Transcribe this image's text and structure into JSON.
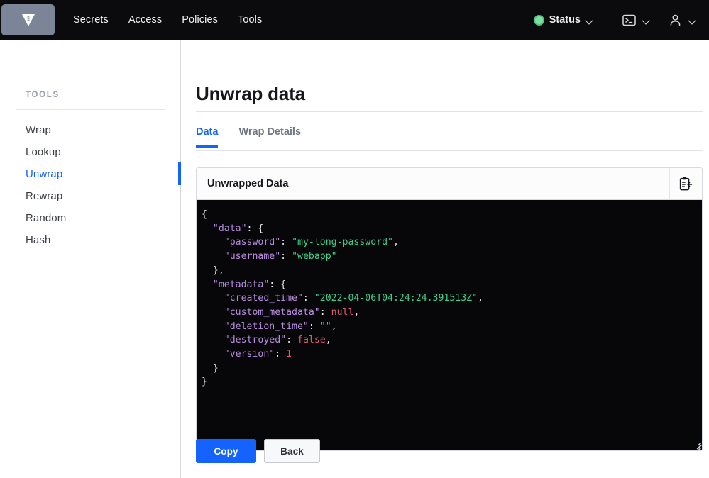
{
  "navbar": {
    "logo_icon": "vault-logo-icon",
    "links": [
      {
        "label": "Secrets"
      },
      {
        "label": "Access"
      },
      {
        "label": "Policies"
      },
      {
        "label": "Tools"
      }
    ],
    "status": {
      "label": "Status",
      "dot_color": "#7fdfa2",
      "chevron": "chevron-down-icon"
    },
    "console_icon": "console-icon",
    "user_icon": "user-icon"
  },
  "sidebar": {
    "title": "TOOLS",
    "items": [
      {
        "label": "Wrap",
        "active": false
      },
      {
        "label": "Lookup",
        "active": false
      },
      {
        "label": "Unwrap",
        "active": true
      },
      {
        "label": "Rewrap",
        "active": false
      },
      {
        "label": "Random",
        "active": false
      },
      {
        "label": "Hash",
        "active": false
      }
    ],
    "active_color": "#1563ff"
  },
  "main": {
    "page_title": "Unwrap data",
    "tabs": [
      {
        "label": "Data",
        "active": true
      },
      {
        "label": "Wrap Details",
        "active": false
      }
    ],
    "card": {
      "header_title": "Unwrapped Data",
      "copy_icon": "clipboard-copy-icon",
      "code_lines": [
        [
          {
            "t": "{",
            "c": "p"
          }
        ],
        [
          {
            "t": "  ",
            "c": "p"
          },
          {
            "t": "\"data\"",
            "c": "k"
          },
          {
            "t": ": {",
            "c": "p"
          }
        ],
        [
          {
            "t": "    ",
            "c": "p"
          },
          {
            "t": "\"password\"",
            "c": "k"
          },
          {
            "t": ": ",
            "c": "p"
          },
          {
            "t": "\"my-long-password\"",
            "c": "s"
          },
          {
            "t": ",",
            "c": "p"
          }
        ],
        [
          {
            "t": "    ",
            "c": "p"
          },
          {
            "t": "\"username\"",
            "c": "k"
          },
          {
            "t": ": ",
            "c": "p"
          },
          {
            "t": "\"webapp\"",
            "c": "s"
          }
        ],
        [
          {
            "t": "  },",
            "c": "p"
          }
        ],
        [
          {
            "t": "  ",
            "c": "p"
          },
          {
            "t": "\"metadata\"",
            "c": "k"
          },
          {
            "t": ": {",
            "c": "p"
          }
        ],
        [
          {
            "t": "    ",
            "c": "p"
          },
          {
            "t": "\"created_time\"",
            "c": "k"
          },
          {
            "t": ": ",
            "c": "p"
          },
          {
            "t": "\"2022-04-06T04:24:24.391513Z\"",
            "c": "s"
          },
          {
            "t": ",",
            "c": "p"
          }
        ],
        [
          {
            "t": "    ",
            "c": "p"
          },
          {
            "t": "\"custom_metadata\"",
            "c": "k"
          },
          {
            "t": ": ",
            "c": "p"
          },
          {
            "t": "null",
            "c": "lit"
          },
          {
            "t": ",",
            "c": "p"
          }
        ],
        [
          {
            "t": "    ",
            "c": "p"
          },
          {
            "t": "\"deletion_time\"",
            "c": "k"
          },
          {
            "t": ": ",
            "c": "p"
          },
          {
            "t": "\"\"",
            "c": "s"
          },
          {
            "t": ",",
            "c": "p"
          }
        ],
        [
          {
            "t": "    ",
            "c": "p"
          },
          {
            "t": "\"destroyed\"",
            "c": "k"
          },
          {
            "t": ": ",
            "c": "p"
          },
          {
            "t": "false",
            "c": "lit"
          },
          {
            "t": ",",
            "c": "p"
          }
        ],
        [
          {
            "t": "    ",
            "c": "p"
          },
          {
            "t": "\"version\"",
            "c": "k"
          },
          {
            "t": ": ",
            "c": "p"
          },
          {
            "t": "1",
            "c": "lit"
          }
        ],
        [
          {
            "t": "  }",
            "c": "p"
          }
        ],
        [
          {
            "t": "}",
            "c": "p"
          }
        ]
      ],
      "code_colors": {
        "background": "#07070a",
        "key": "#b98ce0",
        "string": "#3ecf8e",
        "literal": "#e4586f",
        "punctuation": "#e6e6ea"
      }
    },
    "buttons": [
      {
        "label": "Copy",
        "style": "primary"
      },
      {
        "label": "Back",
        "style": "secondary"
      }
    ]
  }
}
